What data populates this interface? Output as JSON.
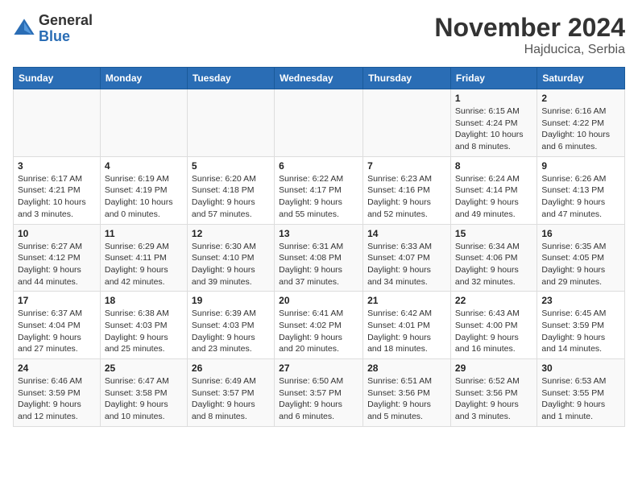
{
  "logo": {
    "general": "General",
    "blue": "Blue"
  },
  "title": "November 2024",
  "location": "Hajducica, Serbia",
  "weekdays": [
    "Sunday",
    "Monday",
    "Tuesday",
    "Wednesday",
    "Thursday",
    "Friday",
    "Saturday"
  ],
  "weeks": [
    [
      {
        "day": "",
        "info": ""
      },
      {
        "day": "",
        "info": ""
      },
      {
        "day": "",
        "info": ""
      },
      {
        "day": "",
        "info": ""
      },
      {
        "day": "",
        "info": ""
      },
      {
        "day": "1",
        "info": "Sunrise: 6:15 AM\nSunset: 4:24 PM\nDaylight: 10 hours and 8 minutes."
      },
      {
        "day": "2",
        "info": "Sunrise: 6:16 AM\nSunset: 4:22 PM\nDaylight: 10 hours and 6 minutes."
      }
    ],
    [
      {
        "day": "3",
        "info": "Sunrise: 6:17 AM\nSunset: 4:21 PM\nDaylight: 10 hours and 3 minutes."
      },
      {
        "day": "4",
        "info": "Sunrise: 6:19 AM\nSunset: 4:19 PM\nDaylight: 10 hours and 0 minutes."
      },
      {
        "day": "5",
        "info": "Sunrise: 6:20 AM\nSunset: 4:18 PM\nDaylight: 9 hours and 57 minutes."
      },
      {
        "day": "6",
        "info": "Sunrise: 6:22 AM\nSunset: 4:17 PM\nDaylight: 9 hours and 55 minutes."
      },
      {
        "day": "7",
        "info": "Sunrise: 6:23 AM\nSunset: 4:16 PM\nDaylight: 9 hours and 52 minutes."
      },
      {
        "day": "8",
        "info": "Sunrise: 6:24 AM\nSunset: 4:14 PM\nDaylight: 9 hours and 49 minutes."
      },
      {
        "day": "9",
        "info": "Sunrise: 6:26 AM\nSunset: 4:13 PM\nDaylight: 9 hours and 47 minutes."
      }
    ],
    [
      {
        "day": "10",
        "info": "Sunrise: 6:27 AM\nSunset: 4:12 PM\nDaylight: 9 hours and 44 minutes."
      },
      {
        "day": "11",
        "info": "Sunrise: 6:29 AM\nSunset: 4:11 PM\nDaylight: 9 hours and 42 minutes."
      },
      {
        "day": "12",
        "info": "Sunrise: 6:30 AM\nSunset: 4:10 PM\nDaylight: 9 hours and 39 minutes."
      },
      {
        "day": "13",
        "info": "Sunrise: 6:31 AM\nSunset: 4:08 PM\nDaylight: 9 hours and 37 minutes."
      },
      {
        "day": "14",
        "info": "Sunrise: 6:33 AM\nSunset: 4:07 PM\nDaylight: 9 hours and 34 minutes."
      },
      {
        "day": "15",
        "info": "Sunrise: 6:34 AM\nSunset: 4:06 PM\nDaylight: 9 hours and 32 minutes."
      },
      {
        "day": "16",
        "info": "Sunrise: 6:35 AM\nSunset: 4:05 PM\nDaylight: 9 hours and 29 minutes."
      }
    ],
    [
      {
        "day": "17",
        "info": "Sunrise: 6:37 AM\nSunset: 4:04 PM\nDaylight: 9 hours and 27 minutes."
      },
      {
        "day": "18",
        "info": "Sunrise: 6:38 AM\nSunset: 4:03 PM\nDaylight: 9 hours and 25 minutes."
      },
      {
        "day": "19",
        "info": "Sunrise: 6:39 AM\nSunset: 4:03 PM\nDaylight: 9 hours and 23 minutes."
      },
      {
        "day": "20",
        "info": "Sunrise: 6:41 AM\nSunset: 4:02 PM\nDaylight: 9 hours and 20 minutes."
      },
      {
        "day": "21",
        "info": "Sunrise: 6:42 AM\nSunset: 4:01 PM\nDaylight: 9 hours and 18 minutes."
      },
      {
        "day": "22",
        "info": "Sunrise: 6:43 AM\nSunset: 4:00 PM\nDaylight: 9 hours and 16 minutes."
      },
      {
        "day": "23",
        "info": "Sunrise: 6:45 AM\nSunset: 3:59 PM\nDaylight: 9 hours and 14 minutes."
      }
    ],
    [
      {
        "day": "24",
        "info": "Sunrise: 6:46 AM\nSunset: 3:59 PM\nDaylight: 9 hours and 12 minutes."
      },
      {
        "day": "25",
        "info": "Sunrise: 6:47 AM\nSunset: 3:58 PM\nDaylight: 9 hours and 10 minutes."
      },
      {
        "day": "26",
        "info": "Sunrise: 6:49 AM\nSunset: 3:57 PM\nDaylight: 9 hours and 8 minutes."
      },
      {
        "day": "27",
        "info": "Sunrise: 6:50 AM\nSunset: 3:57 PM\nDaylight: 9 hours and 6 minutes."
      },
      {
        "day": "28",
        "info": "Sunrise: 6:51 AM\nSunset: 3:56 PM\nDaylight: 9 hours and 5 minutes."
      },
      {
        "day": "29",
        "info": "Sunrise: 6:52 AM\nSunset: 3:56 PM\nDaylight: 9 hours and 3 minutes."
      },
      {
        "day": "30",
        "info": "Sunrise: 6:53 AM\nSunset: 3:55 PM\nDaylight: 9 hours and 1 minute."
      }
    ]
  ]
}
